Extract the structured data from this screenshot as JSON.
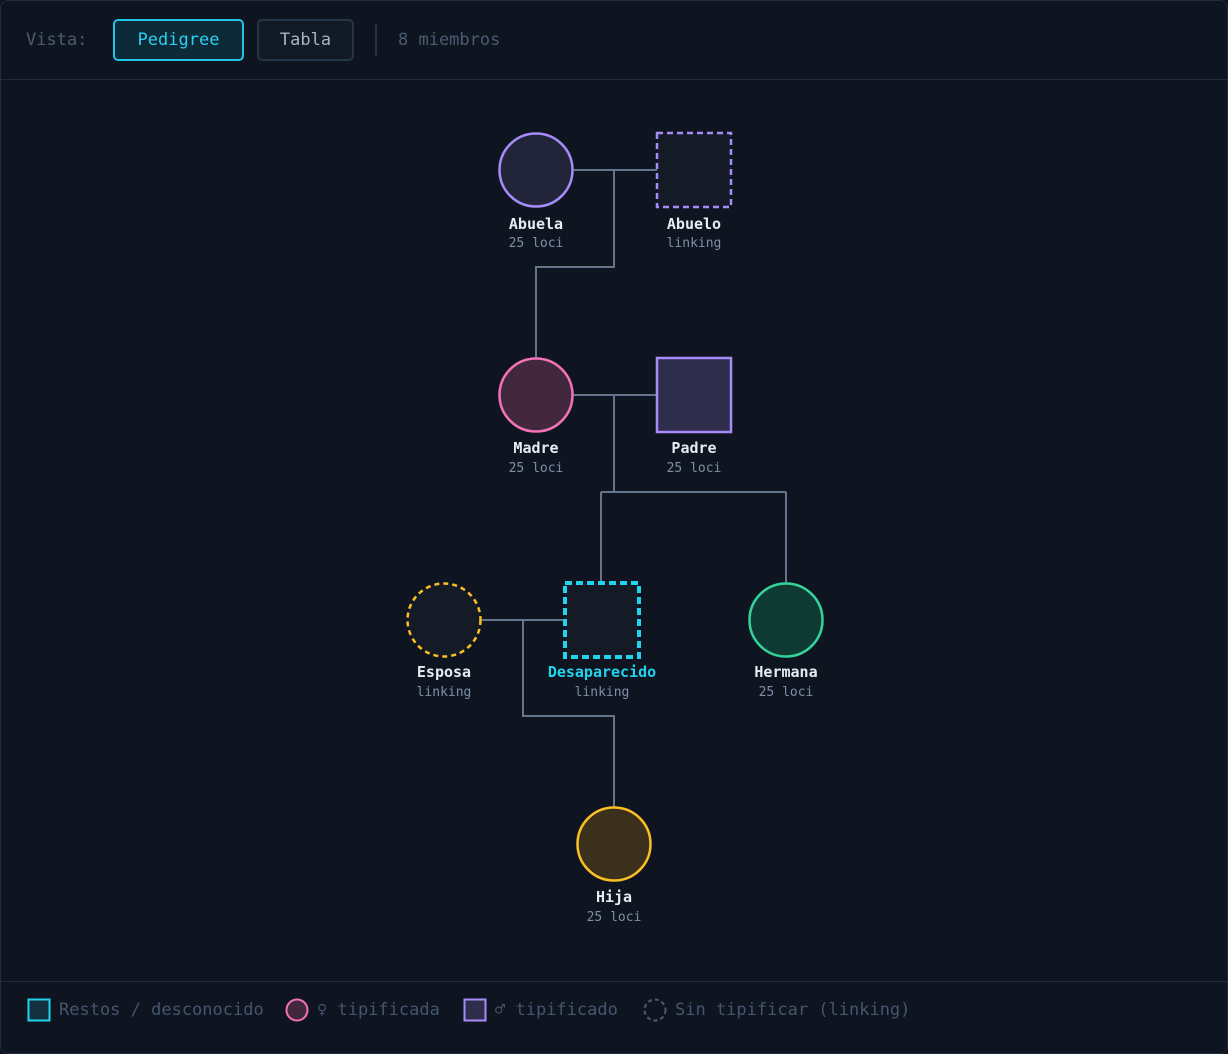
{
  "toolbar": {
    "view_label": "Vista:",
    "pedigree_label": "Pedigree",
    "table_label": "Tabla",
    "member_count": "8 miembros"
  },
  "colors": {
    "accent": "#22d3ee",
    "female": "#f472b6",
    "male": "#a78bfa",
    "sister": "#34d399",
    "daughter": "#fbbf24",
    "line": "#64748b"
  },
  "members": [
    {
      "name": "Abuela",
      "sub": "25 loci",
      "sex": "female",
      "status": "typed",
      "color": "#a78bfa",
      "fill": "#22243a"
    },
    {
      "name": "Abuelo",
      "sub": "linking",
      "sex": "male",
      "status": "untyped",
      "color": "#a78bfa",
      "fill": "#141a26"
    },
    {
      "name": "Madre",
      "sub": "25 loci",
      "sex": "female",
      "status": "typed",
      "color": "#f472b6",
      "fill": "#42283c"
    },
    {
      "name": "Padre",
      "sub": "25 loci",
      "sex": "male",
      "status": "typed",
      "color": "#a78bfa",
      "fill": "#2e2d4c"
    },
    {
      "name": "Esposa",
      "sub": "linking",
      "sex": "female",
      "status": "untyped",
      "color": "#fbbf24",
      "fill": "#141a26"
    },
    {
      "name": "Desaparecido",
      "sub": "linking",
      "sex": "male",
      "status": "missing",
      "color": "#22d3ee",
      "fill": "#141a26"
    },
    {
      "name": "Hermana",
      "sub": "25 loci",
      "sex": "female",
      "status": "typed",
      "color": "#34d399",
      "fill": "#0f3a34"
    },
    {
      "name": "Hija",
      "sub": "25 loci",
      "sex": "female",
      "status": "typed",
      "color": "#fbbf24",
      "fill": "#3a301c"
    }
  ],
  "legend": {
    "remains": "Restos / desconocido",
    "female_typed": "♀ tipificada",
    "male_typed": "♂ tipificado",
    "untyped": "Sin tipificar (linking)"
  }
}
